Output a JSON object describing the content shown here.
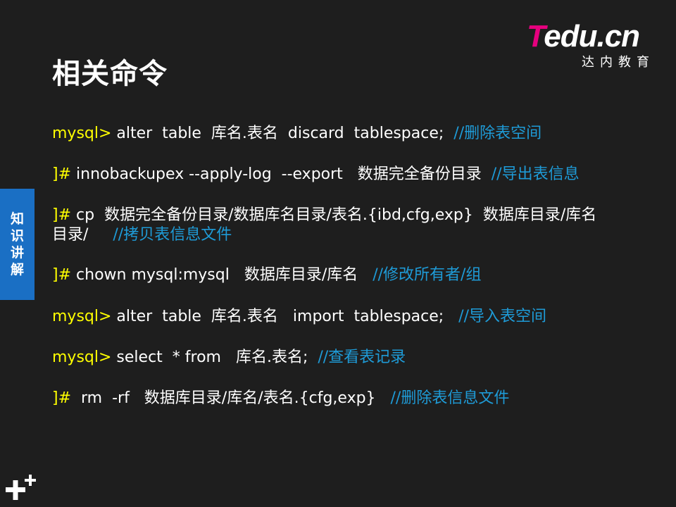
{
  "title": "相关命令",
  "logo": {
    "mark_t": "T",
    "mark_rest": "edu.cn",
    "subtitle": "达内教育"
  },
  "side_tab": {
    "chars": [
      "知",
      "识",
      "讲",
      "解"
    ]
  },
  "commands": [
    {
      "prompt": "mysql>",
      "code": " alter  table  库名.表名  discard  tablespace; ",
      "comment": " //删除表空间"
    },
    {
      "prompt": "]#",
      "code": " innobackupex --apply-log  --export   数据完全备份目录 ",
      "comment": " //导出表信息"
    },
    {
      "prompt": "]#",
      "code": " cp  数据完全备份目录/数据库名目录/表名.{ibd,cfg,exp}  数据库目录/库名",
      "code2": "目录/    ",
      "comment": " //拷贝表信息文件"
    },
    {
      "prompt": "]#",
      "code": " chown mysql:mysql   数据库目录/库名  ",
      "comment": " //修改所有者/组"
    },
    {
      "prompt": "mysql>",
      "code": " alter  table  库名.表名   import  tablespace;  ",
      "comment": " //导入表空间"
    },
    {
      "prompt": "mysql>",
      "code": " select  * from   库名.表名; ",
      "comment": " //查看表记录"
    },
    {
      "prompt": "]#",
      "code": "  rm  -rf   数据库目录/库名/表名.{cfg,exp}  ",
      "comment": " //删除表信息文件"
    }
  ],
  "colors": {
    "background": "#1e1e1e",
    "prompt": "#ffff00",
    "comment": "#1e9bd7",
    "side_tab": "#1a6fc4",
    "logo_accent": "#e6007e"
  },
  "icons": {
    "corner": "plus-plus-icon"
  }
}
